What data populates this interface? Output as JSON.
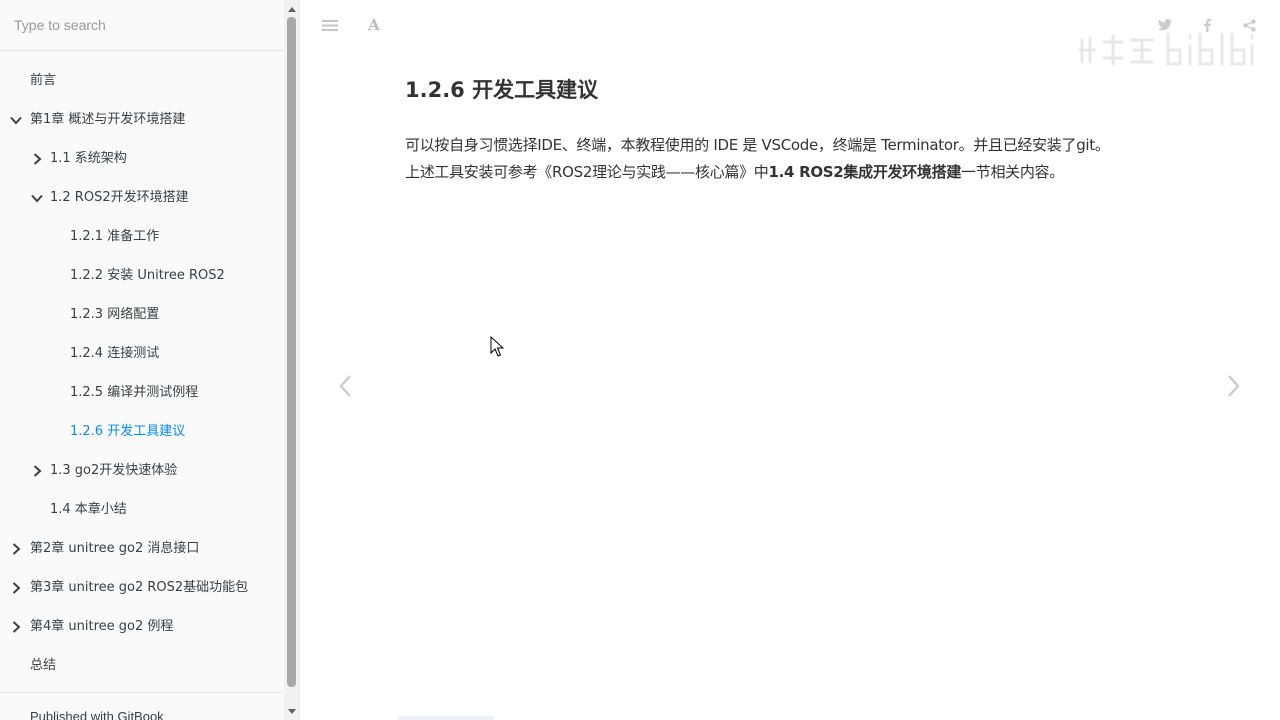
{
  "search": {
    "placeholder": "Type to search"
  },
  "toc": [
    {
      "label": "前言",
      "level": 0,
      "arrow": "none",
      "active": false
    },
    {
      "label": "第1章 概述与开发环境搭建",
      "level": 0,
      "arrow": "down",
      "active": false
    },
    {
      "label": "1.1 系统架构",
      "level": 1,
      "arrow": "right",
      "active": false
    },
    {
      "label": "1.2 ROS2开发环境搭建",
      "level": 1,
      "arrow": "down",
      "active": false
    },
    {
      "label": "1.2.1 准备工作",
      "level": 2,
      "arrow": "none",
      "active": false
    },
    {
      "label": "1.2.2 安装 Unitree ROS2",
      "level": 2,
      "arrow": "none",
      "active": false
    },
    {
      "label": "1.2.3 网络配置",
      "level": 2,
      "arrow": "none",
      "active": false
    },
    {
      "label": "1.2.4 连接测试",
      "level": 2,
      "arrow": "none",
      "active": false
    },
    {
      "label": "1.2.5 编译并测试例程",
      "level": 2,
      "arrow": "none",
      "active": false
    },
    {
      "label": "1.2.6 开发工具建议",
      "level": 2,
      "arrow": "none",
      "active": true
    },
    {
      "label": "1.3 go2开发快速体验",
      "level": 1,
      "arrow": "right",
      "active": false
    },
    {
      "label": "1.4 本章小结",
      "level": 1,
      "arrow": "none",
      "active": false
    },
    {
      "label": "第2章 unitree go2 消息接口",
      "level": 0,
      "arrow": "right",
      "active": false
    },
    {
      "label": "第3章 unitree go2 ROS2基础功能包",
      "level": 0,
      "arrow": "right",
      "active": false
    },
    {
      "label": "第4章 unitree go2 例程",
      "level": 0,
      "arrow": "right",
      "active": false
    },
    {
      "label": "总结",
      "level": 0,
      "arrow": "none",
      "active": false
    }
  ],
  "footer": {
    "published": "Published with GitBook"
  },
  "header": {
    "menu_icon": "menu-icon",
    "font_settings_label": "A",
    "share_icons": [
      "twitter-icon",
      "facebook-icon",
      "share-icon"
    ]
  },
  "page": {
    "title": "1.2.6 开发工具建议",
    "para_line1": "可以按自身习惯选择IDE、终端，本教程使用的 IDE 是 VSCode，终端是 Terminator。并且已经安装了git。",
    "para_line2_pre": "上述工具安装可参考《ROS2理论与实践——核心篇》中",
    "para_line2_bold": "1.4 ROS2集成开发环境搭建",
    "para_line2_post": "一节相关内容。"
  },
  "colors": {
    "accent": "#008cff",
    "text": "#333333",
    "sidebar_bg": "#fafafa",
    "icon_gray": "#cccccc"
  }
}
